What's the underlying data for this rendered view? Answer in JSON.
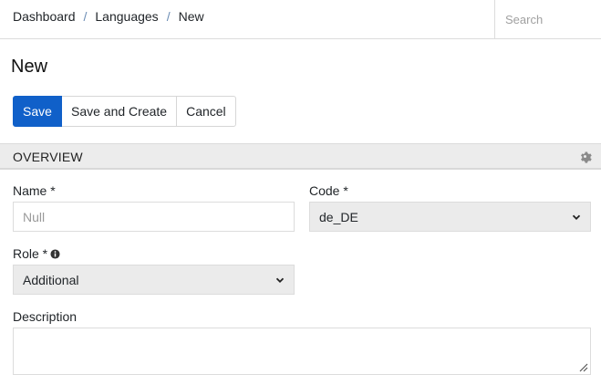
{
  "breadcrumb": {
    "items": [
      "Dashboard",
      "Languages",
      "New"
    ],
    "separator": "/"
  },
  "search": {
    "placeholder": "Search",
    "value": ""
  },
  "page": {
    "title": "New"
  },
  "toolbar": {
    "save_label": "Save",
    "save_create_label": "Save and Create",
    "cancel_label": "Cancel"
  },
  "section": {
    "title": "OVERVIEW",
    "settings_icon": "gear-icon"
  },
  "form": {
    "name": {
      "label": "Name *",
      "placeholder": "Null",
      "value": ""
    },
    "code": {
      "label": "Code *",
      "value": "de_DE"
    },
    "role": {
      "label": "Role *",
      "value": "Additional",
      "info_icon": "info-icon"
    },
    "description": {
      "label": "Description",
      "value": ""
    }
  },
  "colors": {
    "primary": "#1060c9",
    "separator": "#6c8db5",
    "section_bg": "#ececec",
    "select_bg": "#ebebeb"
  }
}
